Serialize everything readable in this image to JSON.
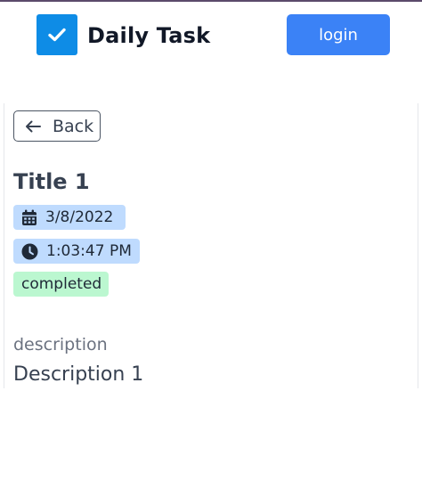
{
  "header": {
    "app_title": "Daily Task",
    "login_label": "login",
    "logo_icon": "check-square-icon"
  },
  "colors": {
    "brand": "#0e8ce6",
    "primary_button": "#3b82f6",
    "date_badge": "#bfdbfe",
    "status_badge": "#bbf7d0"
  },
  "task": {
    "back_label": "Back",
    "back_icon": "arrow-left-icon",
    "title": "Title 1",
    "date": "3/8/2022",
    "date_icon": "calendar-icon",
    "time": "1:03:47 PM",
    "time_icon": "clock-icon",
    "status": "completed",
    "description_label": "description",
    "description": "Description 1"
  }
}
